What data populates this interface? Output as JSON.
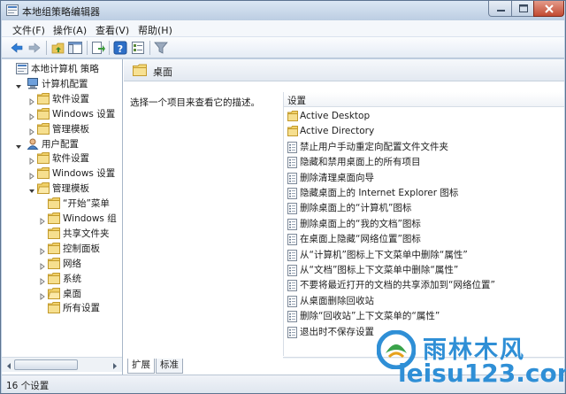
{
  "window": {
    "title": "本地组策略编辑器"
  },
  "menu": [
    "文件(F)",
    "操作(A)",
    "查看(V)",
    "帮助(H)"
  ],
  "toolbar": {
    "icons": [
      "back-icon",
      "forward-icon",
      "up-folder-icon",
      "show-hide-tree-icon",
      "export-list-icon",
      "help-icon",
      "properties-icon",
      "filter-icon"
    ]
  },
  "tree": {
    "items": [
      {
        "label": "本地计算机 策略"
      },
      {
        "label": "计算机配置"
      },
      {
        "label": "软件设置"
      },
      {
        "label": "Windows 设置"
      },
      {
        "label": "管理模板"
      },
      {
        "label": "用户配置"
      },
      {
        "label": "软件设置"
      },
      {
        "label": "Windows 设置"
      },
      {
        "label": "管理模板"
      },
      {
        "label": "“开始”菜单"
      },
      {
        "label": "Windows 组"
      },
      {
        "label": "共享文件夹"
      },
      {
        "label": "控制面板"
      },
      {
        "label": "网络"
      },
      {
        "label": "系统"
      },
      {
        "label": "桌面"
      },
      {
        "label": "所有设置"
      }
    ]
  },
  "pane": {
    "title": "桌面",
    "description": "选择一个项目来查看它的描述。"
  },
  "list": {
    "header": "设置",
    "items": [
      {
        "label": "Active Desktop",
        "type": "folder"
      },
      {
        "label": "Active Directory",
        "type": "folder"
      },
      {
        "label": "禁止用户手动重定向配置文件文件夹",
        "type": "setting"
      },
      {
        "label": "隐藏和禁用桌面上的所有项目",
        "type": "setting"
      },
      {
        "label": "删除清理桌面向导",
        "type": "setting"
      },
      {
        "label": "隐藏桌面上的 Internet Explorer 图标",
        "type": "setting"
      },
      {
        "label": "删除桌面上的“计算机”图标",
        "type": "setting"
      },
      {
        "label": "删除桌面上的“我的文档”图标",
        "type": "setting"
      },
      {
        "label": "在桌面上隐藏“网络位置”图标",
        "type": "setting"
      },
      {
        "label": "从“计算机”图标上下文菜单中删除“属性”",
        "type": "setting"
      },
      {
        "label": "从“文档”图标上下文菜单中删除“属性”",
        "type": "setting"
      },
      {
        "label": "不要将最近打开的文档的共享添加到“网络位置”",
        "type": "setting"
      },
      {
        "label": "从桌面删除回收站",
        "type": "setting"
      },
      {
        "label": "删除“回收站”上下文菜单的“属性”",
        "type": "setting"
      },
      {
        "label": "退出时不保存设置",
        "type": "setting"
      }
    ]
  },
  "tabs": [
    "扩展",
    "标准"
  ],
  "status": {
    "text": "16 个设置"
  },
  "watermark": {
    "brand": "雨林木风",
    "url": "leisu123.com"
  }
}
